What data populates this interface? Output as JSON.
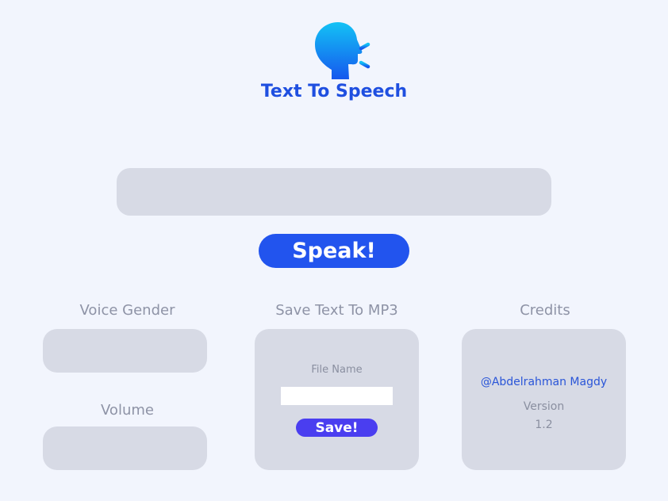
{
  "header": {
    "title": "Text To Speech",
    "logo_icon": "speaking-head-icon"
  },
  "main": {
    "text_input": {
      "value": "",
      "placeholder": ""
    },
    "speak_label": "Speak!"
  },
  "voice_gender": {
    "label": "Voice Gender",
    "value": ""
  },
  "volume": {
    "label": "Volume",
    "value": ""
  },
  "save_mp3": {
    "label": "Save Text To MP3",
    "file_name_label": "File Name",
    "file_name_value": "",
    "save_label": "Save!"
  },
  "credits": {
    "label": "Credits",
    "author": "@Abdelrahman Magdy",
    "version_label": "Version",
    "version": "1.2"
  },
  "colors": {
    "background": "#f2f5fd",
    "accent": "#1f4fe0",
    "speak_button": "#2254ee",
    "save_button": "#4a3ef0",
    "panel": "#d7dae5"
  }
}
